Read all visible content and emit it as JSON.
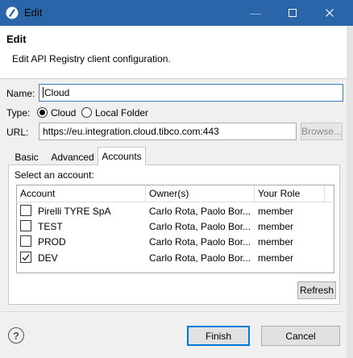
{
  "window": {
    "title": "Edit",
    "minimize_glyph": "—",
    "maximize_glyph": "☐",
    "close_glyph": "✕"
  },
  "header": {
    "title": "Edit",
    "description": "Edit API Registry client configuration."
  },
  "form": {
    "name_label": "Name:",
    "name_value": "Cloud",
    "type_label": "Type:",
    "type_options": [
      {
        "label": "Cloud",
        "selected": true
      },
      {
        "label": "Local Folder",
        "selected": false
      }
    ],
    "url_label": "URL:",
    "url_value": "https://eu.integration.cloud.tibco.com:443",
    "browse_label": "Browse..."
  },
  "tabs": [
    {
      "label": "Basic",
      "active": false
    },
    {
      "label": "Advanced",
      "active": false
    },
    {
      "label": "Accounts",
      "active": true
    }
  ],
  "accounts": {
    "prompt": "Select an account:",
    "columns": [
      "Account",
      "Owner(s)",
      "Your Role"
    ],
    "rows": [
      {
        "account": "Pirelli TYRE SpA",
        "owners": "Carlo Rota, Paolo Bor...",
        "role": "member",
        "checked": false
      },
      {
        "account": "TEST",
        "owners": "Carlo Rota, Paolo Bor...",
        "role": "member",
        "checked": false
      },
      {
        "account": "PROD",
        "owners": "Carlo Rota, Paolo Bor...",
        "role": "member",
        "checked": false
      },
      {
        "account": "DEV",
        "owners": "Carlo Rota, Paolo Bor...",
        "role": "member",
        "checked": true
      }
    ],
    "refresh_label": "Refresh"
  },
  "footer": {
    "help_glyph": "?",
    "finish_label": "Finish",
    "cancel_label": "Cancel"
  }
}
